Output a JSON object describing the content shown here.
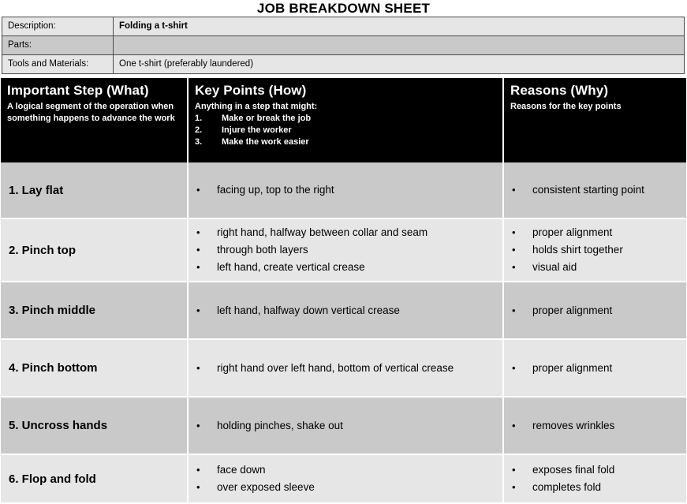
{
  "document": {
    "title": "JOB BREAKDOWN SHEET"
  },
  "meta": {
    "rows": [
      {
        "label": "Description:",
        "value": "Folding a t-shirt",
        "bold": true
      },
      {
        "label": "Parts:",
        "value": "",
        "bold": false
      },
      {
        "label": "Tools and Materials:",
        "value": "One t-shirt (preferably laundered)",
        "bold": false
      }
    ]
  },
  "table_header": {
    "col1": {
      "title": "Important Step (What)",
      "subtitle": "A logical segment of the operation when something happens to advance the work"
    },
    "col2": {
      "title": "Key Points (How)",
      "subtitle": "Anything in a step that might:",
      "items": [
        {
          "num": "1.",
          "text": "Make or break the job"
        },
        {
          "num": "2.",
          "text": "Injure the worker"
        },
        {
          "num": "3.",
          "text": "Make the work easier"
        }
      ]
    },
    "col3": {
      "title": "Reasons (Why)",
      "subtitle": "Reasons for the key points"
    }
  },
  "rows": [
    {
      "step": "1. Lay flat",
      "key_points": [
        "facing up, top to the right"
      ],
      "reasons": [
        "consistent starting point"
      ]
    },
    {
      "step": "2. Pinch top",
      "key_points": [
        "right hand, halfway between collar and seam",
        "through both layers",
        "left hand, create vertical crease"
      ],
      "reasons": [
        "proper alignment",
        "holds shirt together",
        "visual aid"
      ]
    },
    {
      "step": "3. Pinch middle",
      "key_points": [
        "left hand, halfway down vertical crease"
      ],
      "reasons": [
        "proper alignment"
      ]
    },
    {
      "step": "4. Pinch bottom",
      "key_points": [
        "right hand over left hand, bottom of vertical crease"
      ],
      "reasons": [
        "proper alignment"
      ]
    },
    {
      "step": "5. Uncross hands",
      "key_points": [
        "holding pinches, shake out"
      ],
      "reasons": [
        "removes wrinkles"
      ]
    },
    {
      "step": "6. Flop and fold",
      "key_points": [
        "face down",
        "over exposed sleeve"
      ],
      "reasons": [
        "exposes final fold",
        "completes fold"
      ]
    }
  ],
  "colors": {
    "row_dark": "#c9c9c9",
    "row_light": "#e6e6e6",
    "header_bg": "#000000",
    "header_fg": "#ffffff",
    "meta_border": "#4a4a4a"
  },
  "glyphs": {
    "bullet": "•"
  }
}
